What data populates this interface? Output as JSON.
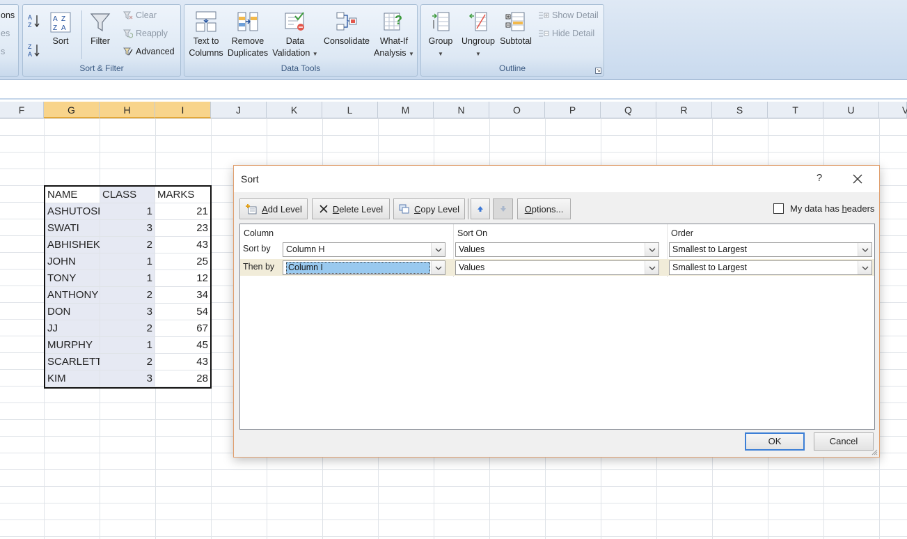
{
  "ribbon": {
    "cut_left_top": "ons",
    "cut_left_mid": "es",
    "cut_left_bot": "s",
    "sort_filter": {
      "label": "Sort & Filter",
      "sort": "Sort",
      "filter": "Filter",
      "clear": "Clear",
      "reapply": "Reapply",
      "advanced": "Advanced"
    },
    "data_tools": {
      "label": "Data Tools",
      "text_to_columns_1": "Text to",
      "text_to_columns_2": "Columns",
      "remove_duplicates_1": "Remove",
      "remove_duplicates_2": "Duplicates",
      "data_validation_1": "Data",
      "data_validation_2": "Validation",
      "consolidate": "Consolidate",
      "what_if_1": "What-If",
      "what_if_2": "Analysis"
    },
    "outline": {
      "label": "Outline",
      "group": "Group",
      "ungroup": "Ungroup",
      "subtotal": "Subtotal",
      "show_detail": "Show Detail",
      "hide_detail": "Hide Detail"
    }
  },
  "columns": [
    "F",
    "G",
    "H",
    "I",
    "J",
    "K",
    "L",
    "M",
    "N",
    "O",
    "P",
    "Q",
    "R",
    "S",
    "T",
    "U",
    "V"
  ],
  "table": {
    "headers": [
      "NAME",
      "CLASS",
      "MARKS"
    ],
    "rows": [
      [
        "ASHUTOSH",
        "1",
        "21"
      ],
      [
        "SWATI",
        "3",
        "23"
      ],
      [
        "ABHISHEK",
        "2",
        "43"
      ],
      [
        "JOHN",
        "1",
        "25"
      ],
      [
        "TONY",
        "1",
        "12"
      ],
      [
        "ANTHONY",
        "2",
        "34"
      ],
      [
        "DON",
        "3",
        "54"
      ],
      [
        "JJ",
        "2",
        "67"
      ],
      [
        "MURPHY",
        "1",
        "45"
      ],
      [
        "SCARLETT",
        "2",
        "43"
      ],
      [
        "KIM",
        "3",
        "28"
      ]
    ]
  },
  "dialog": {
    "title": "Sort",
    "help": "?",
    "toolbar": {
      "add_level_u": "A",
      "add_level_rest": "dd Level",
      "delete_level_u": "D",
      "delete_level_rest": "elete Level",
      "copy_level_u": "C",
      "copy_level_rest": "opy Level",
      "options_u": "O",
      "options_rest": "ptions..."
    },
    "headers_checkbox": {
      "label_pre": "My data has ",
      "label_u": "h",
      "label_post": "eaders",
      "checked": false
    },
    "grid_headers": {
      "column": "Column",
      "sort_on": "Sort On",
      "order": "Order"
    },
    "levels": [
      {
        "label": "Sort by",
        "column": "Column H",
        "sort_on": "Values",
        "order": "Smallest to Largest"
      },
      {
        "label": "Then by",
        "column": "Column I",
        "sort_on": "Values",
        "order": "Smallest to Largest"
      }
    ],
    "ok": "OK",
    "cancel": "Cancel"
  }
}
